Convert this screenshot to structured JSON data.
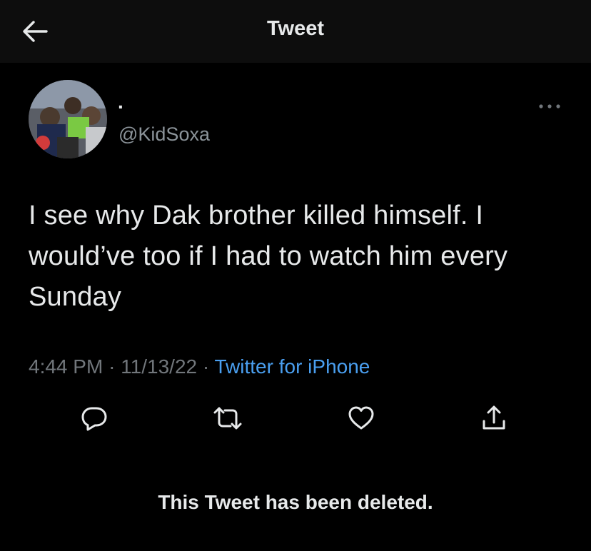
{
  "header": {
    "title": "Tweet",
    "back_icon": "arrow-left-icon"
  },
  "tweet": {
    "author": {
      "display_name": ".",
      "handle": "@KidSoxa",
      "avatar": "avatar-photo"
    },
    "more_icon": "more-horizontal-icon",
    "text": "I see why Dak brother killed himself. I would’ve too if I had to watch him every Sunday",
    "meta": {
      "time": "4:44 PM",
      "separator": "·",
      "date": "11/13/22",
      "source": "Twitter for iPhone"
    },
    "actions": [
      {
        "icon": "reply-icon"
      },
      {
        "icon": "retweet-icon"
      },
      {
        "icon": "like-icon"
      },
      {
        "icon": "share-icon"
      }
    ]
  },
  "notice": "This Tweet has been deleted.",
  "colors": {
    "background": "#000000",
    "header_bg": "#0d0d0d",
    "text": "#e7e9ea",
    "secondary_text": "#71767b",
    "link": "#4a9ff0"
  }
}
